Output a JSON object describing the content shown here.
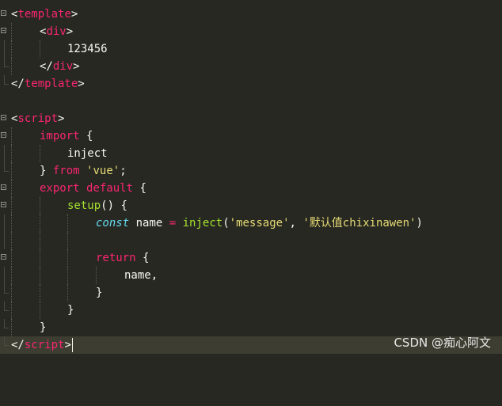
{
  "code": {
    "tag_template": "template",
    "tag_div": "div",
    "div_text": "123456",
    "tag_script": "script",
    "kw_import": "import",
    "brace_open": "{",
    "brace_close": "}",
    "ident_inject": "inject",
    "kw_from": "from",
    "str_vue": "'vue'",
    "semicolon": ";",
    "kw_export": "export",
    "kw_default": "default",
    "fn_setup": "setup",
    "parens": "()",
    "kw_const": "const",
    "ident_name": "name",
    "op_eq": "=",
    "fn_inject": "inject",
    "str_message": "'message'",
    "comma": ",",
    "str_default": "'默认值chixinawen'",
    "paren_close": ")",
    "kw_return": "return",
    "name_comma": "name,"
  },
  "watermark": "CSDN @痴心阿文",
  "colors": {
    "background": "#272822",
    "active_line": "#3e3d32",
    "tag": "#f92672",
    "keyword": "#f92672",
    "string": "#e6db74",
    "function": "#a6e22e",
    "storage": "#66d9ef",
    "text": "#f8f8f2"
  }
}
